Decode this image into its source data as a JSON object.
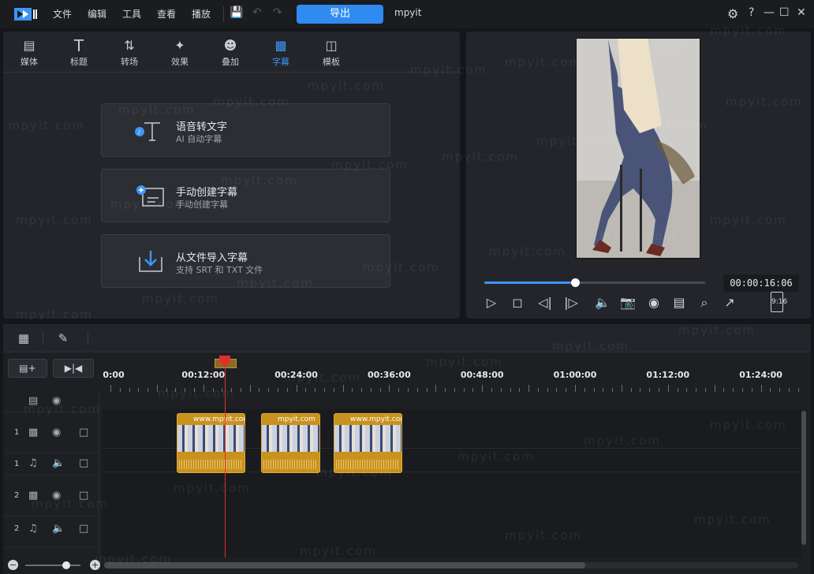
{
  "app": {
    "project_name": "mpyit",
    "export_label": "导出"
  },
  "menu": [
    "文件",
    "编辑",
    "工具",
    "查看",
    "播放"
  ],
  "tool_tabs": [
    {
      "label": "媒体",
      "icon": "media-icon"
    },
    {
      "label": "标题",
      "icon": "title-icon"
    },
    {
      "label": "转场",
      "icon": "transition-icon"
    },
    {
      "label": "效果",
      "icon": "effect-icon"
    },
    {
      "label": "叠加",
      "icon": "overlay-icon"
    },
    {
      "label": "字幕",
      "icon": "subtitle-icon"
    },
    {
      "label": "模板",
      "icon": "template-icon"
    }
  ],
  "active_tab": "字幕",
  "caption_options": [
    {
      "title": "语音转文字",
      "subtitle": "AI 自动字幕",
      "icon": "speech-to-text-icon"
    },
    {
      "title": "手动创建字幕",
      "subtitle": "手动创建字幕",
      "icon": "manual-subtitle-icon"
    },
    {
      "title": "从文件导入字幕",
      "subtitle": "支持 SRT 和 TXT 文件",
      "icon": "import-subtitle-icon"
    }
  ],
  "preview": {
    "timecode": "00:00:16:06",
    "aspect_ratio": "9:16",
    "progress_fraction": 0.41
  },
  "ruler": {
    "labels": [
      "0:00",
      "00:12:00",
      "00:24:00",
      "00:36:00",
      "00:48:00",
      "01:00:00",
      "01:12:00",
      "01:24:00"
    ]
  },
  "tracks": [
    {
      "num": "",
      "type": "subtitle"
    },
    {
      "num": "1",
      "type": "video"
    },
    {
      "num": "1",
      "type": "audio"
    },
    {
      "num": "2",
      "type": "video"
    },
    {
      "num": "2",
      "type": "audio"
    }
  ],
  "clips": [
    {
      "label": "www.mpyit.com"
    },
    {
      "label": "mpyit.com"
    },
    {
      "label": "www.mpyit.com"
    }
  ],
  "watermark": "mpyit.com",
  "colors": {
    "accent": "#2f8bf0",
    "clip": "#c8921e",
    "playhead": "#e0302b"
  }
}
